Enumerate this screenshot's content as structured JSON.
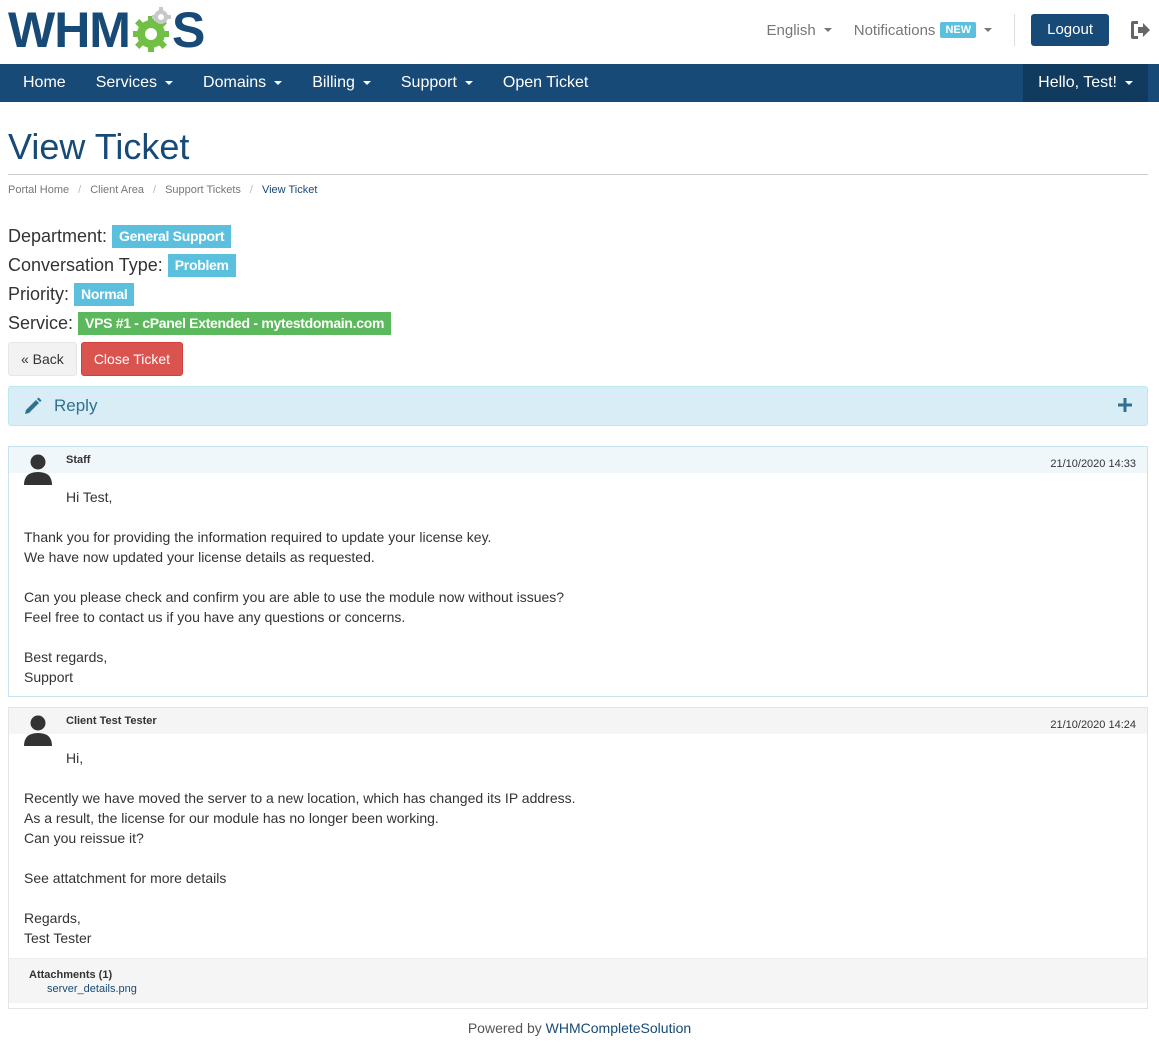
{
  "brand": {
    "logo_text_left": "WHM",
    "logo_text_right": "S",
    "colors": {
      "primary": "#174a76",
      "info": "#5bc0de",
      "success": "#5cb85c",
      "danger": "#d9534f",
      "gear_green": "#71bf44"
    }
  },
  "topbar": {
    "language": "English",
    "notifications": "Notifications",
    "notifications_badge": "NEW",
    "logout": "Logout",
    "exit_icon": "sign-out-icon"
  },
  "nav": {
    "items": [
      {
        "label": "Home"
      },
      {
        "label": "Services"
      },
      {
        "label": "Domains"
      },
      {
        "label": "Billing"
      },
      {
        "label": "Support"
      },
      {
        "label": "Open Ticket"
      }
    ],
    "account": "Hello, Test!"
  },
  "page": {
    "title": "View Ticket",
    "breadcrumb": [
      "Portal Home",
      "Client Area",
      "Support Tickets",
      "View Ticket"
    ]
  },
  "ticket": {
    "department_label": "Department:",
    "department": "General Support",
    "conversation_type_label": "Conversation Type:",
    "conversation_type": "Problem",
    "priority_label": "Priority:",
    "priority": "Normal",
    "service_label": "Service:",
    "service": "VPS #1 - cPanel Extended - mytestdomain.com"
  },
  "buttons": {
    "back": "« Back",
    "close": "Close Ticket"
  },
  "reply": {
    "label": "Reply",
    "icon": "pencil-icon",
    "expand_icon": "plus-icon"
  },
  "messages": [
    {
      "author": "Staff",
      "date": "21/10/2020 14:33",
      "lines": [
        "Hi Test,",
        "",
        "Thank you for providing the information required to update your license key.",
        "We have now updated your license details as requested.",
        "",
        "Can you please check and confirm you are able to use the module now without issues?",
        "Feel free to contact us if you have any questions or concerns.",
        "",
        "Best regards,",
        "Support"
      ]
    },
    {
      "author": "Client Test Tester",
      "date": "21/10/2020 14:24",
      "lines": [
        "Hi,",
        "",
        "Recently we have moved the server to a new location, which has changed its IP address.",
        "As a result, the license for our module has no longer been working.",
        "Can you reissue it?",
        "",
        "See attatchment for more details",
        "",
        "Regards,",
        "Test Tester"
      ],
      "attachments_title": "Attachments (1)",
      "attachment": "server_details.png"
    }
  ],
  "footer": {
    "prefix": "Powered by",
    "link": "WHMCompleteSolution"
  }
}
